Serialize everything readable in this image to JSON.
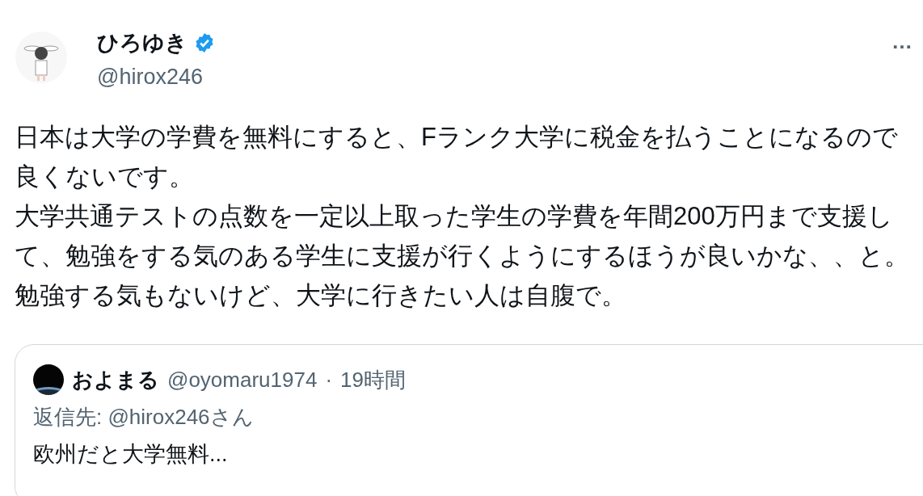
{
  "author": {
    "name": "ひろゆき",
    "verified": true,
    "handle": "@hirox246"
  },
  "more": "…",
  "body": [
    "日本は大学の学費を無料にすると、Fランク大学に税金を払うことになるので良くないです。",
    "大学共通テストの点数を一定以上取った学生の学費を年間200万円まで支援して、勉強をする気のある学生に支援が行くようにするほうが良いかな、、と。",
    "勉強する気もないけど、大学に行きたい人は自腹で。"
  ],
  "quote": {
    "name": "およまる",
    "handle": "@oyomaru1974",
    "separator": "·",
    "time": "19時間",
    "reply_to": "返信先: @hirox246さん",
    "text": "欧州だと大学無料..."
  }
}
